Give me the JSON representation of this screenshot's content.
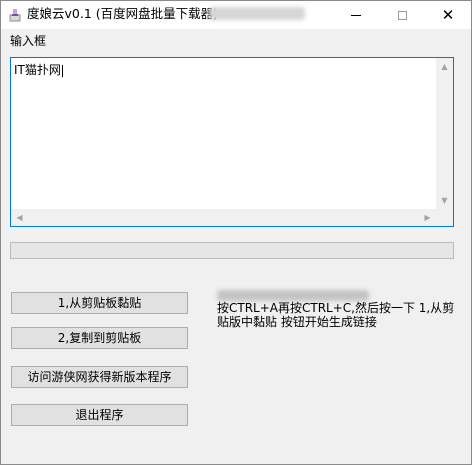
{
  "window": {
    "title": "度娘云v0.1 (百度网盘批量下载器)",
    "close_glyph": "✕"
  },
  "input": {
    "label": "输入框",
    "value": "IT猫扑网"
  },
  "progress": {
    "value_percent": 0
  },
  "buttons": {
    "paste": "1,从剪贴板黏贴",
    "copy": "2,复制到剪贴板",
    "visit": "访问游侠网获得新版本程序",
    "exit": "退出程序"
  },
  "hint": {
    "text": "按CTRL+A再按CTRL+C,然后按一下 1,从剪贴版中黏贴 按钮开始生成链接"
  },
  "colors": {
    "focus_border": "#0078d7",
    "button_face": "#e1e1e1",
    "window_bg": "#f0f0f0"
  }
}
